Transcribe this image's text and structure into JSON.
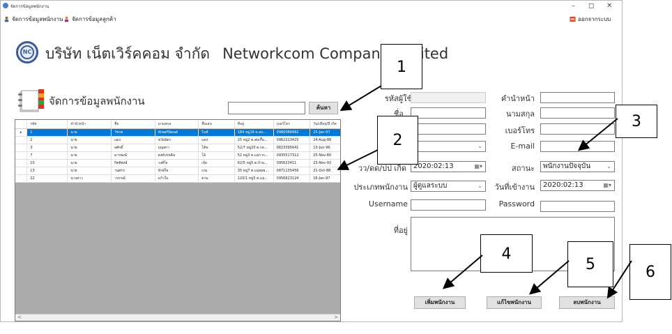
{
  "window": {
    "title": "จัดการข้อมูลพนักงาน",
    "controls": [
      "–",
      "◻",
      "✕"
    ]
  },
  "menu": {
    "items": [
      {
        "label": "จัดการข้อมูลพนักงาน",
        "icon": "person-icon"
      },
      {
        "label": "จัดการข้อมูลลูกค้า",
        "icon": "customer-icon"
      }
    ],
    "exit_label": "ออกจากระบบ",
    "exit_icon": "exit-icon"
  },
  "company": {
    "logo_text": "NC",
    "name_th": "บริษัท เน็ตเวิร์คคอม จำกัด",
    "name_en": "Networkcom Company Limited"
  },
  "section_title": "จัดการข้อมูลพนักงาน",
  "search": {
    "value": "",
    "button_label": "ค้นหา"
  },
  "table": {
    "columns": [
      "รหัส",
      "คำนำหน้า",
      "ชื่อ",
      "นามสกุล",
      "ชื่อเล่น",
      "ที่อยู่",
      "เบอร์โทร",
      "วัน/เดือน/ปี เกิด"
    ],
    "rows": [
      [
        "1",
        "นาย",
        "วัชรพ",
        "ทักษศรีจัดนดั",
        "ไนท์",
        "184 หมู่18 ต.สบ...",
        "0980088482",
        "25-Jan-97"
      ],
      [
        "2",
        "นาย",
        "แดง",
        "ขวัยมัตร",
        "แดง",
        "25 หมู่2 ต.สบเกื้อ...",
        "0962213425",
        "24-Aug-88"
      ],
      [
        "3",
        "นาย",
        "ลศักดิ์",
        "บุญสกา",
        "โต้ท",
        "52/7 หมู่20 ต.กย...",
        "0823395641",
        "13-Jun-96"
      ],
      [
        "7",
        "นาย",
        "มารพงษ์",
        "สงค์ปรหลิน",
        "โอ้",
        "52 หมู่3 ต.แม่ราก...",
        "0935517312",
        "25-Nov-80"
      ],
      [
        "10",
        "นาย",
        "กิตติพงษ์",
        "วงศ์ใจ",
        "เจ้ย",
        "62/5 หมู่5 ต.บ้าน...",
        "095623411",
        "23-Nov-92"
      ],
      [
        "13",
        "นาย",
        "วนศกร",
        "จักษ์ใจ",
        "เกม",
        "35 หมู่7 ต.แม่สอย...",
        "0871135456",
        "21-Oct-88"
      ],
      [
        "22",
        "นางสาว",
        "วรกรณ์",
        "แก้วใจ",
        "ตาม",
        "120/1 หมู่5 ต.แม่...",
        "0956623124",
        "16-Jan-97"
      ]
    ],
    "scroll_left": "<",
    "scroll_right": ">"
  },
  "form": {
    "emp_id_label": "รหัสผู้ใช้",
    "emp_id_value": "",
    "first_name_label": "ชื่อ",
    "first_name_value": "",
    "gender_value": "",
    "dob_label": "วว/ดด/ปป เกิด",
    "dob_value": "2020:02:13",
    "emp_type_label": "ประเภทพนักงาน",
    "emp_type_value": "ผู้ดูแลระบบ",
    "username_label": "Username",
    "username_value": "",
    "address_label": "ที่อยู่",
    "address_value": "",
    "prefix_label": "คำนำหน้า",
    "prefix_value": "",
    "last_name_label": "นามสกุล",
    "last_name_value": "",
    "phone_label": "เบอร์โทร",
    "phone_value": "",
    "email_label": "E-mail",
    "email_value": "",
    "status_label": "สถานะ",
    "status_value": "พนักงานปัจจุบัน",
    "start_date_label": "วันที่เข้างาน",
    "start_date_value": "2020:02:13",
    "password_label": "Password",
    "password_value": ""
  },
  "buttons": {
    "add": "เพิ่มพนักงาน",
    "edit": "แก้ไขพนักงาน",
    "delete": "ลบพนักงาน"
  },
  "callouts": [
    "1",
    "2",
    "3",
    "4",
    "5",
    "6"
  ],
  "colors": {
    "selection": "#0078d7",
    "grid_background": "#ababab",
    "logo": "#3a5a9a"
  }
}
